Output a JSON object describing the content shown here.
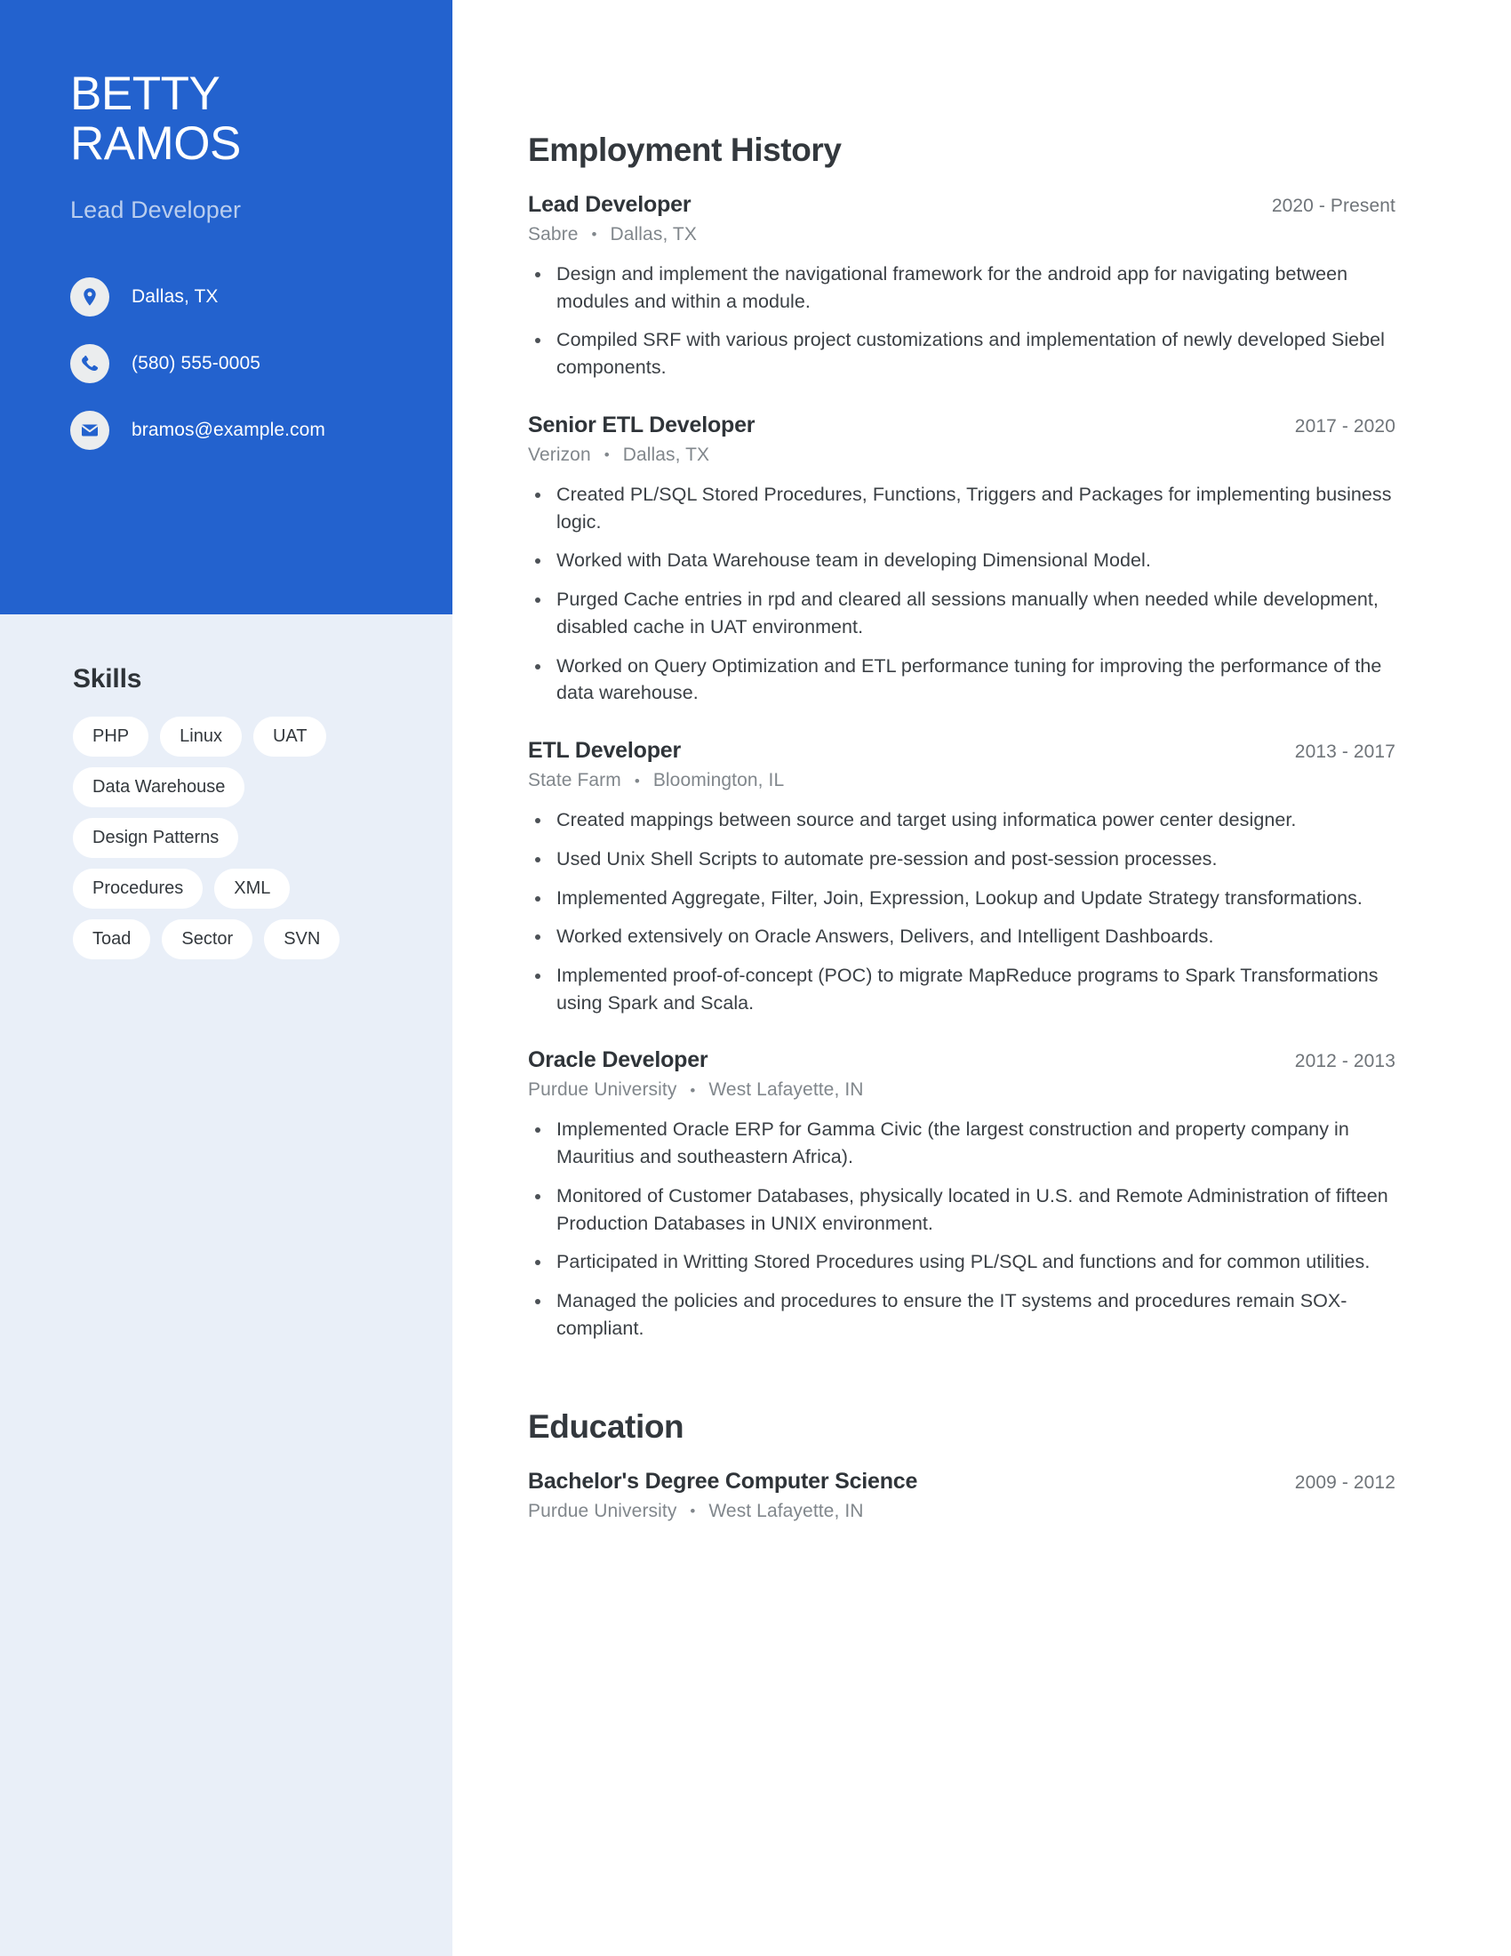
{
  "profile": {
    "first_name": "BETTY",
    "last_name": "RAMOS",
    "job_title": "Lead Developer"
  },
  "contact": [
    {
      "icon": "location-pin-icon",
      "value": "Dallas, TX"
    },
    {
      "icon": "phone-icon",
      "value": "(580) 555-0005"
    },
    {
      "icon": "email-icon",
      "value": "bramos@example.com"
    }
  ],
  "skills": {
    "title": "Skills",
    "items": [
      "PHP",
      "Linux",
      "UAT",
      "Data Warehouse",
      "Design Patterns",
      "Procedures",
      "XML",
      "Toad",
      "Sector",
      "SVN"
    ]
  },
  "employment": {
    "title": "Employment History",
    "separator": "•",
    "jobs": [
      {
        "role": "Lead Developer",
        "dates": "2020 - Present",
        "company": "Sabre",
        "location": "Dallas, TX",
        "bullets": [
          "Design and implement the navigational framework for the android app for navigating between modules and within a module.",
          "Compiled SRF with various project customizations and implementation of newly developed Siebel components."
        ]
      },
      {
        "role": "Senior ETL Developer",
        "dates": "2017 - 2020",
        "company": "Verizon",
        "location": "Dallas, TX",
        "bullets": [
          "Created PL/SQL Stored Procedures, Functions, Triggers and Packages for implementing business logic.",
          "Worked with Data Warehouse team in developing Dimensional Model.",
          "Purged Cache entries in rpd and cleared all sessions manually when needed while development, disabled cache in UAT environment.",
          "Worked on Query Optimization and ETL performance tuning for improving the performance of the data warehouse."
        ]
      },
      {
        "role": "ETL Developer",
        "dates": "2013 - 2017",
        "company": "State Farm",
        "location": "Bloomington, IL",
        "bullets": [
          "Created mappings between source and target using informatica power center designer.",
          "Used Unix Shell Scripts to automate pre-session and post-session processes.",
          "Implemented Aggregate, Filter, Join, Expression, Lookup and Update Strategy transformations.",
          "Worked extensively on Oracle Answers, Delivers, and Intelligent Dashboards.",
          "Implemented proof-of-concept (POC) to migrate MapReduce programs to Spark Transformations using Spark and Scala."
        ]
      },
      {
        "role": "Oracle Developer",
        "dates": "2012 - 2013",
        "company": "Purdue University",
        "location": "West Lafayette, IN",
        "bullets": [
          "Implemented Oracle ERP for Gamma Civic (the largest construction and property company in Mauritius and southeastern Africa).",
          "Monitored of Customer Databases, physically located in U.S. and Remote Administration of fifteen Production Databases in UNIX environment.",
          "Participated in Writting Stored Procedures using PL/SQL and functions and for common utilities.",
          "Managed the policies and procedures to ensure the IT systems and procedures remain SOX-compliant."
        ]
      }
    ]
  },
  "education": {
    "title": "Education",
    "entries": [
      {
        "degree": "Bachelor's Degree Computer Science",
        "dates": "2009 - 2012",
        "school": "Purdue University",
        "location": "West Lafayette, IN"
      }
    ]
  },
  "colors": {
    "sidebar_header": "#2362ce",
    "sidebar_body": "#e9eff8",
    "pill_bg": "#ffffff",
    "heading_text": "#33383d",
    "muted_text": "#81878c"
  }
}
